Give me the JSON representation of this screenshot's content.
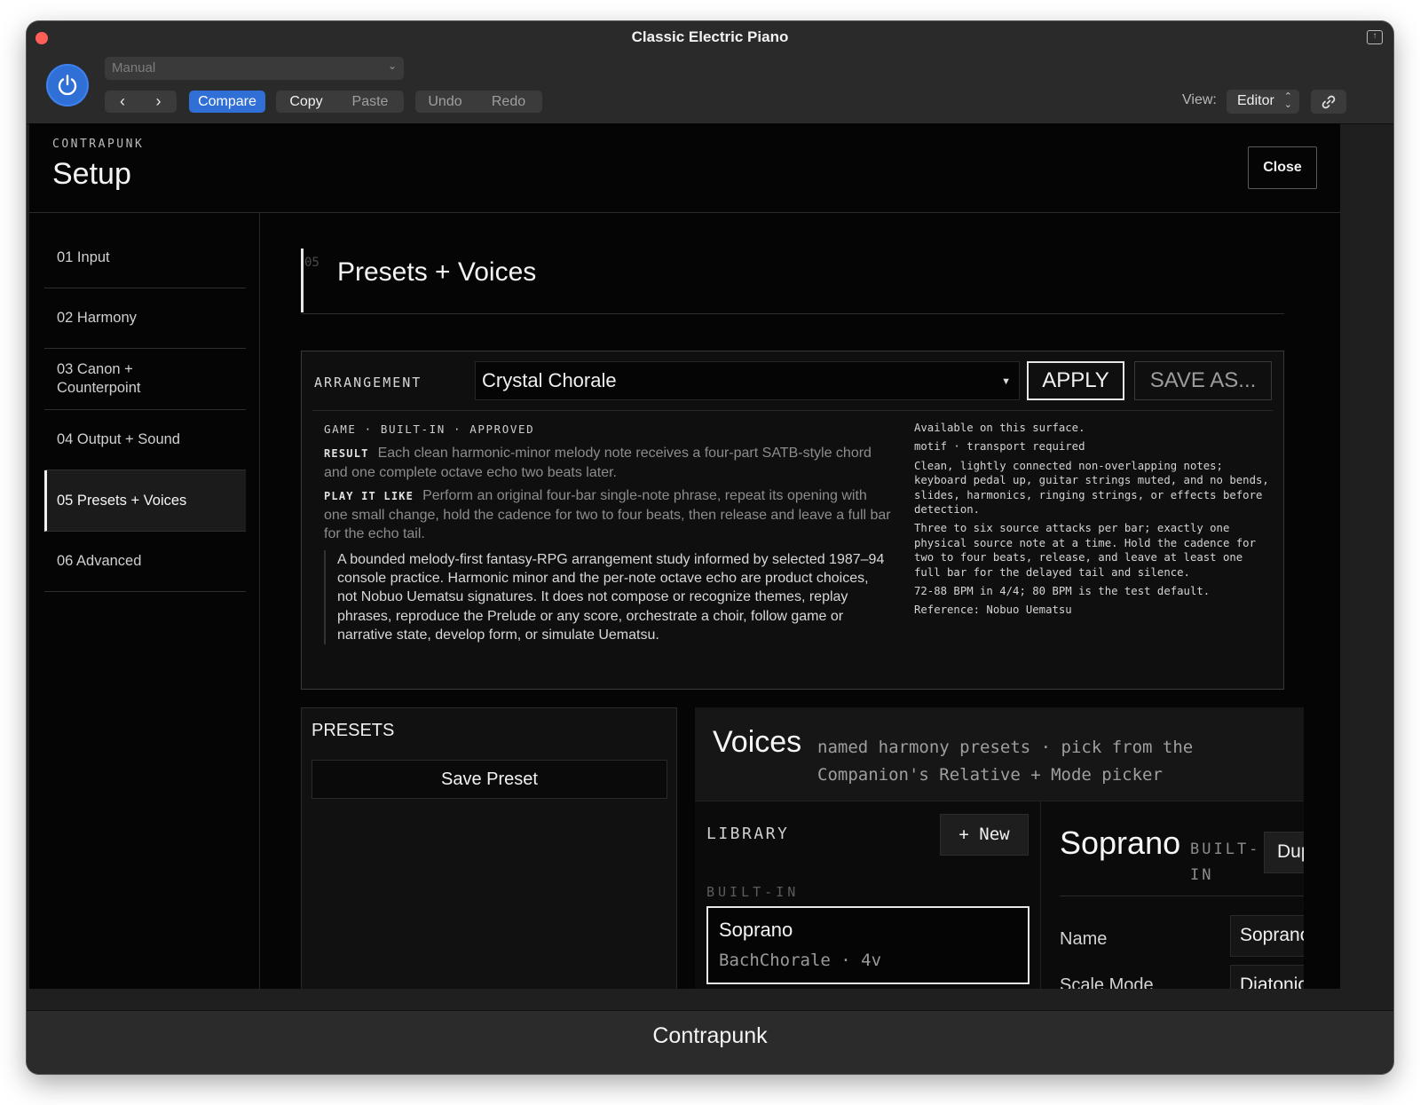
{
  "window": {
    "title": "Classic Electric Piano"
  },
  "toolbar": {
    "preset_select": "Manual",
    "compare": "Compare",
    "copy": "Copy",
    "paste": "Paste",
    "undo": "Undo",
    "redo": "Redo",
    "view_label": "View:",
    "view_value": "Editor"
  },
  "plugin": {
    "brand": "CONTRAPUNK",
    "title": "Setup",
    "close": "Close"
  },
  "sidebar": {
    "items": [
      {
        "label": "01 Input"
      },
      {
        "label": "02 Harmony"
      },
      {
        "label": "03 Canon + Counterpoint"
      },
      {
        "label": "04 Output + Sound"
      },
      {
        "label": "05 Presets + Voices",
        "active": true
      },
      {
        "label": "06 Advanced"
      }
    ]
  },
  "section": {
    "number": "05",
    "title": "Presets + Voices"
  },
  "arrangement": {
    "label": "ARRANGEMENT",
    "selected": "Crystal Chorale",
    "apply": "APPLY",
    "save_as": "SAVE AS...",
    "tags": "GAME · BUILT-IN · APPROVED",
    "result_key": "RESULT",
    "result_text": "Each clean harmonic-minor melody note receives a four-part SATB-style chord and one complete octave echo two beats later.",
    "play_key": "PLAY IT LIKE",
    "play_text": "Perform an original four-bar single-note phrase, repeat its opening with one small change, hold the cadence for two to four beats, then release and leave a full bar for the echo tail.",
    "quote": "A bounded melody-first fantasy-RPG arrangement study informed by selected 1987–94 console practice. Harmonic minor and the per-note octave echo are product choices, not Nobuo Uematsu signatures. It does not compose or recognize themes, replay phrases, reproduce the Prelude or any score, orchestrate a choir, follow game or narrative state, develop form, or simulate Uematsu.",
    "right": {
      "availability": "Available on this surface.",
      "requirements": "motif · transport required",
      "input_note": "Clean, lightly connected non-overlapping notes; keyboard pedal up, guitar strings muted, and no bends, slides, harmonics, ringing strings, or effects before detection.",
      "density_note": "Three to six source attacks per bar; exactly one physical source note at a time. Hold the cadence for two to four beats, release, and leave at least one full bar for the delayed tail and silence.",
      "tempo_note": "72-88 BPM in 4/4; 80 BPM is the test default.",
      "reference": "Reference: Nobuo Uematsu"
    }
  },
  "presets": {
    "title": "PRESETS",
    "save": "Save Preset"
  },
  "voices": {
    "title": "Voices",
    "subtitle": "named harmony presets · pick from the Companion's Relative + Mode picker",
    "library_label": "LIBRARY",
    "new": "+ New",
    "builtin_label": "BUILT-IN",
    "card_name": "Soprano",
    "card_meta": "BachChorale · 4v",
    "detail": {
      "title": "Soprano",
      "tag": "BUILT-IN",
      "duplicate": "Duplicate",
      "name_label": "Name",
      "name_value": "Soprano",
      "scale_label": "Scale Mode",
      "scale_value": "Diatonic"
    }
  },
  "footer": {
    "title": "Contrapunk"
  }
}
